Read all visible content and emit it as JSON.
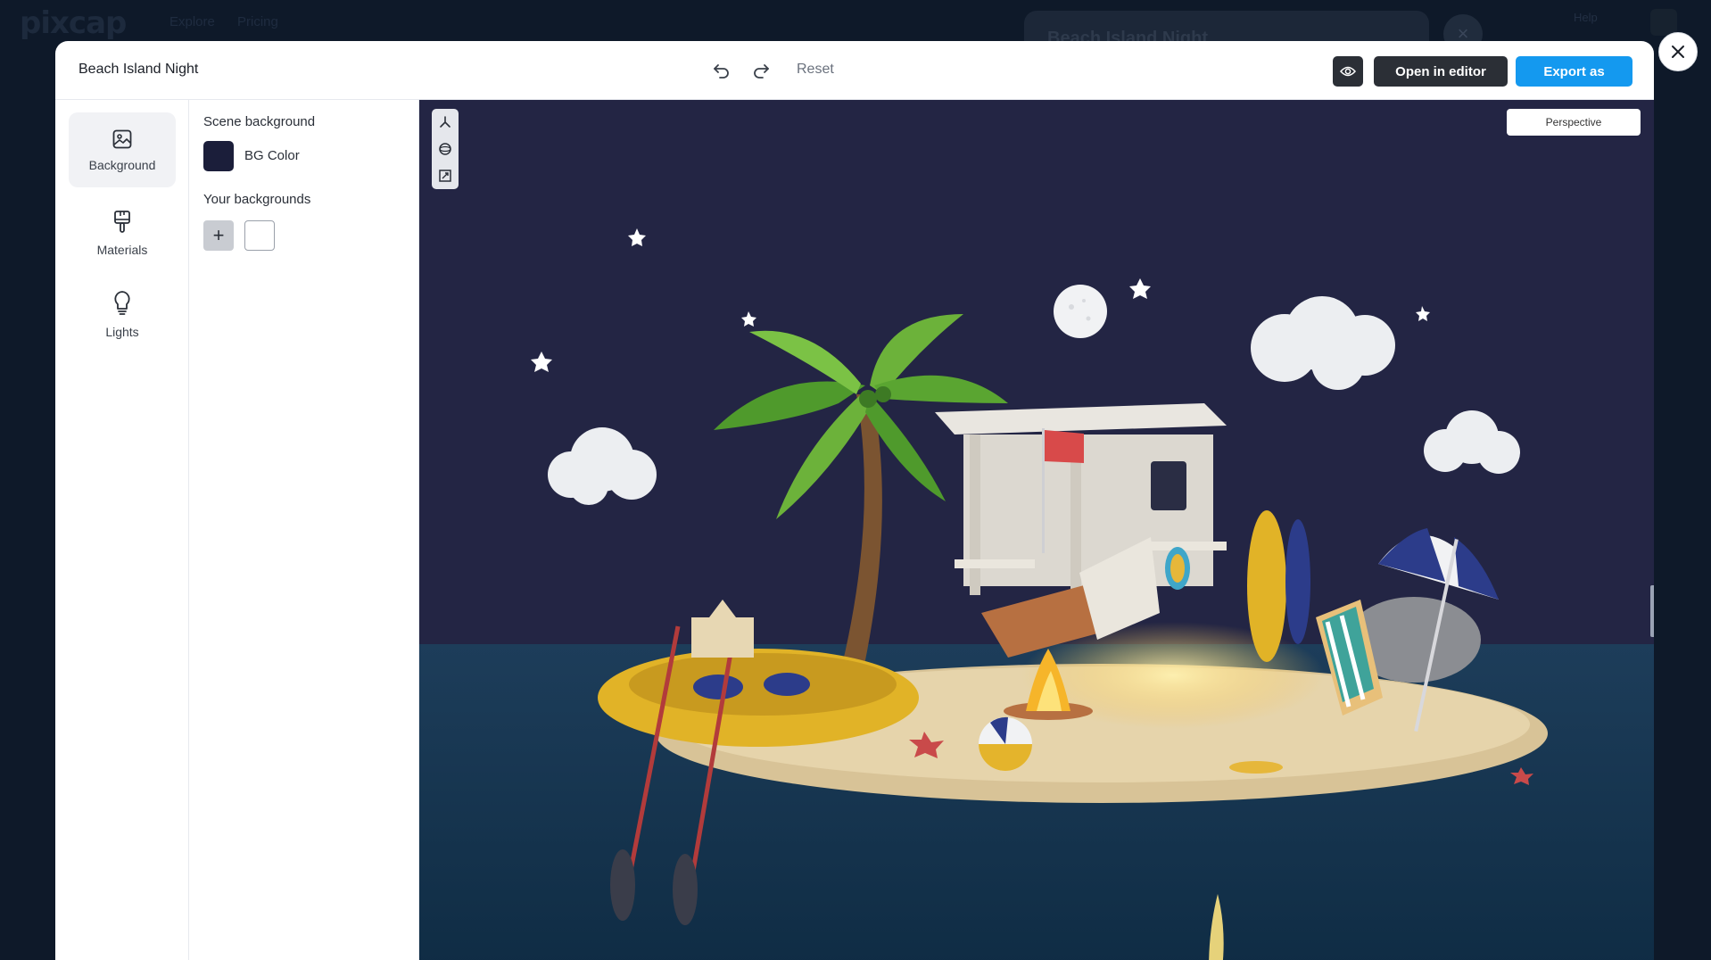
{
  "host": {
    "logo": "pixcap",
    "nav": [
      "Explore",
      "Pricing"
    ],
    "card_title": "Beach Island Night",
    "small_text": "Help"
  },
  "header": {
    "title": "Beach Island Night",
    "undo_icon": "undo-icon",
    "redo_icon": "redo-icon",
    "reset_label": "Reset",
    "preview_icon": "eye-icon",
    "open_editor_label": "Open in editor",
    "export_label": "Export as"
  },
  "leftnav": {
    "items": [
      {
        "label": "Background",
        "icon": "image-icon",
        "active": true
      },
      {
        "label": "Materials",
        "icon": "paintbrush-icon",
        "active": false
      },
      {
        "label": "Lights",
        "icon": "lightbulb-icon",
        "active": false
      }
    ]
  },
  "panel": {
    "scene_background_title": "Scene background",
    "bg_color_label": "BG Color",
    "bg_color_value": "#1b1e3a",
    "your_backgrounds_title": "Your backgrounds",
    "add_label": "+"
  },
  "viewport": {
    "camera_mode": "Perspective",
    "toolbar": [
      "axis-icon",
      "orbit-icon",
      "fit-icon"
    ],
    "sky_color": "#232544",
    "sea_color": "#15384f"
  },
  "colors": {
    "accent": "#1499ef",
    "dark_button": "#2b2f36"
  }
}
